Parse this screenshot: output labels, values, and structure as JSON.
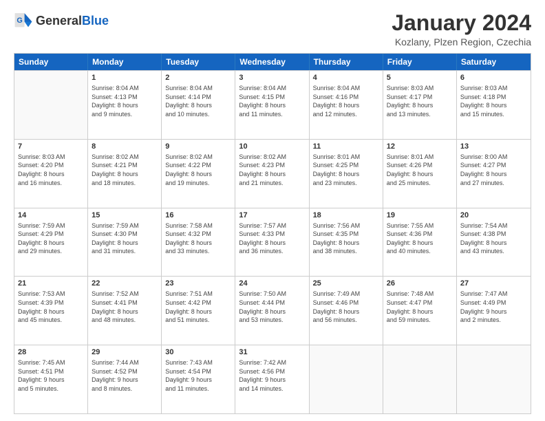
{
  "header": {
    "logo": {
      "general": "General",
      "blue": "Blue"
    },
    "title": "January 2024",
    "location": "Kozlany, Plzen Region, Czechia"
  },
  "days_of_week": [
    "Sunday",
    "Monday",
    "Tuesday",
    "Wednesday",
    "Thursday",
    "Friday",
    "Saturday"
  ],
  "weeks": [
    [
      {
        "day": "",
        "info": ""
      },
      {
        "day": "1",
        "info": "Sunrise: 8:04 AM\nSunset: 4:13 PM\nDaylight: 8 hours\nand 9 minutes."
      },
      {
        "day": "2",
        "info": "Sunrise: 8:04 AM\nSunset: 4:14 PM\nDaylight: 8 hours\nand 10 minutes."
      },
      {
        "day": "3",
        "info": "Sunrise: 8:04 AM\nSunset: 4:15 PM\nDaylight: 8 hours\nand 11 minutes."
      },
      {
        "day": "4",
        "info": "Sunrise: 8:04 AM\nSunset: 4:16 PM\nDaylight: 8 hours\nand 12 minutes."
      },
      {
        "day": "5",
        "info": "Sunrise: 8:03 AM\nSunset: 4:17 PM\nDaylight: 8 hours\nand 13 minutes."
      },
      {
        "day": "6",
        "info": "Sunrise: 8:03 AM\nSunset: 4:18 PM\nDaylight: 8 hours\nand 15 minutes."
      }
    ],
    [
      {
        "day": "7",
        "info": "Sunrise: 8:03 AM\nSunset: 4:20 PM\nDaylight: 8 hours\nand 16 minutes."
      },
      {
        "day": "8",
        "info": "Sunrise: 8:02 AM\nSunset: 4:21 PM\nDaylight: 8 hours\nand 18 minutes."
      },
      {
        "day": "9",
        "info": "Sunrise: 8:02 AM\nSunset: 4:22 PM\nDaylight: 8 hours\nand 19 minutes."
      },
      {
        "day": "10",
        "info": "Sunrise: 8:02 AM\nSunset: 4:23 PM\nDaylight: 8 hours\nand 21 minutes."
      },
      {
        "day": "11",
        "info": "Sunrise: 8:01 AM\nSunset: 4:25 PM\nDaylight: 8 hours\nand 23 minutes."
      },
      {
        "day": "12",
        "info": "Sunrise: 8:01 AM\nSunset: 4:26 PM\nDaylight: 8 hours\nand 25 minutes."
      },
      {
        "day": "13",
        "info": "Sunrise: 8:00 AM\nSunset: 4:27 PM\nDaylight: 8 hours\nand 27 minutes."
      }
    ],
    [
      {
        "day": "14",
        "info": "Sunrise: 7:59 AM\nSunset: 4:29 PM\nDaylight: 8 hours\nand 29 minutes."
      },
      {
        "day": "15",
        "info": "Sunrise: 7:59 AM\nSunset: 4:30 PM\nDaylight: 8 hours\nand 31 minutes."
      },
      {
        "day": "16",
        "info": "Sunrise: 7:58 AM\nSunset: 4:32 PM\nDaylight: 8 hours\nand 33 minutes."
      },
      {
        "day": "17",
        "info": "Sunrise: 7:57 AM\nSunset: 4:33 PM\nDaylight: 8 hours\nand 36 minutes."
      },
      {
        "day": "18",
        "info": "Sunrise: 7:56 AM\nSunset: 4:35 PM\nDaylight: 8 hours\nand 38 minutes."
      },
      {
        "day": "19",
        "info": "Sunrise: 7:55 AM\nSunset: 4:36 PM\nDaylight: 8 hours\nand 40 minutes."
      },
      {
        "day": "20",
        "info": "Sunrise: 7:54 AM\nSunset: 4:38 PM\nDaylight: 8 hours\nand 43 minutes."
      }
    ],
    [
      {
        "day": "21",
        "info": "Sunrise: 7:53 AM\nSunset: 4:39 PM\nDaylight: 8 hours\nand 45 minutes."
      },
      {
        "day": "22",
        "info": "Sunrise: 7:52 AM\nSunset: 4:41 PM\nDaylight: 8 hours\nand 48 minutes."
      },
      {
        "day": "23",
        "info": "Sunrise: 7:51 AM\nSunset: 4:42 PM\nDaylight: 8 hours\nand 51 minutes."
      },
      {
        "day": "24",
        "info": "Sunrise: 7:50 AM\nSunset: 4:44 PM\nDaylight: 8 hours\nand 53 minutes."
      },
      {
        "day": "25",
        "info": "Sunrise: 7:49 AM\nSunset: 4:46 PM\nDaylight: 8 hours\nand 56 minutes."
      },
      {
        "day": "26",
        "info": "Sunrise: 7:48 AM\nSunset: 4:47 PM\nDaylight: 8 hours\nand 59 minutes."
      },
      {
        "day": "27",
        "info": "Sunrise: 7:47 AM\nSunset: 4:49 PM\nDaylight: 9 hours\nand 2 minutes."
      }
    ],
    [
      {
        "day": "28",
        "info": "Sunrise: 7:45 AM\nSunset: 4:51 PM\nDaylight: 9 hours\nand 5 minutes."
      },
      {
        "day": "29",
        "info": "Sunrise: 7:44 AM\nSunset: 4:52 PM\nDaylight: 9 hours\nand 8 minutes."
      },
      {
        "day": "30",
        "info": "Sunrise: 7:43 AM\nSunset: 4:54 PM\nDaylight: 9 hours\nand 11 minutes."
      },
      {
        "day": "31",
        "info": "Sunrise: 7:42 AM\nSunset: 4:56 PM\nDaylight: 9 hours\nand 14 minutes."
      },
      {
        "day": "",
        "info": ""
      },
      {
        "day": "",
        "info": ""
      },
      {
        "day": "",
        "info": ""
      }
    ]
  ]
}
